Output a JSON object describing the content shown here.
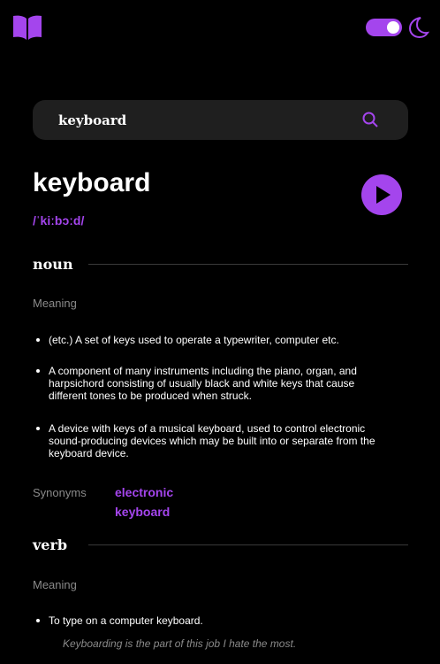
{
  "header": {
    "logo_icon": "book-icon",
    "theme_toggle_on": true,
    "theme_icon": "moon-icon",
    "accent_color": "#a445ed"
  },
  "search": {
    "value": "keyboard",
    "icon": "search-icon"
  },
  "entry": {
    "word": "keyboard",
    "phonetic": "/ˈkiːbɔːd/",
    "play_icon": "play-icon"
  },
  "noun": {
    "part_of_speech": "noun",
    "meaning_label": "Meaning",
    "definitions": [
      "(etc.) A set of keys used to operate a typewriter, computer etc.",
      "A component of many instruments including the piano, organ, and harpsichord consisting of usually black and white keys that cause different tones to be produced when struck.",
      "A device with keys of a musical keyboard, used to control electronic sound-producing devices which may be built into or separate from the keyboard device."
    ],
    "synonyms_label": "Synonyms",
    "synonyms": [
      "electronic",
      "keyboard"
    ]
  },
  "verb": {
    "part_of_speech": "verb",
    "meaning_label": "Meaning",
    "definitions": [
      "To type on a computer keyboard."
    ],
    "example": "Keyboarding is the part of this job I hate the most."
  }
}
